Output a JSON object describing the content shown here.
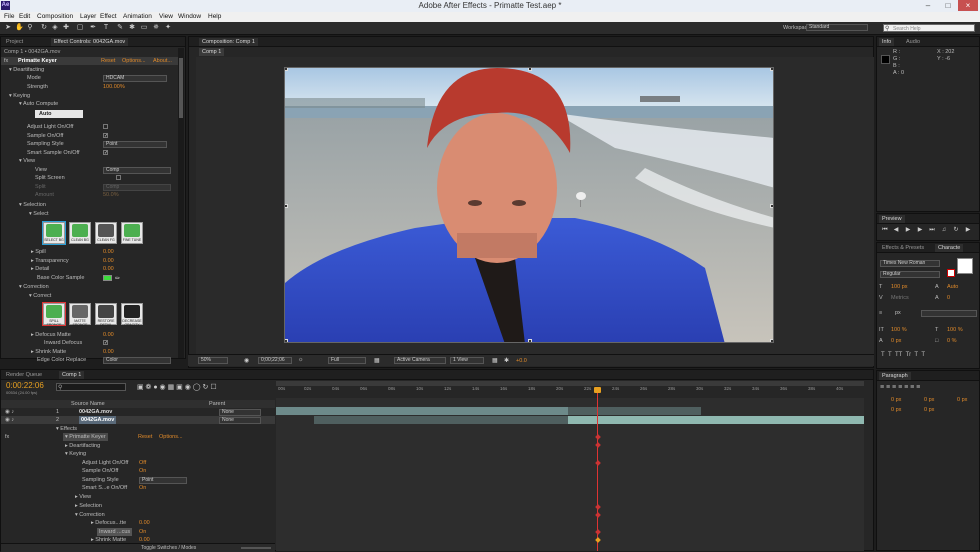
{
  "window": {
    "title": "Adobe After Effects - Primatte Test.aep *",
    "app_icon": "Ae"
  },
  "menu": [
    "File",
    "Edit",
    "Composition",
    "Layer",
    "Effect",
    "Animation",
    "View",
    "Window",
    "Help"
  ],
  "toolbar": {
    "workspace_label": "Workspace:",
    "workspace_value": "Standard",
    "search_placeholder": "Search Help"
  },
  "project_panel": {
    "tabs": [
      "Project",
      "Effect Controls: 0042GA.mov"
    ],
    "breadcrumb": "Comp 1 • 0042GA.mov",
    "effect": {
      "name": "Primatte Keyer",
      "reset": "Reset",
      "options": "Options...",
      "about": "About..."
    },
    "rows": {
      "deartifacting": "Deartifacting",
      "mode": "Mode",
      "mode_value": "HDCAM",
      "strength": "Strength",
      "strength_value": "100.00%",
      "keying": "Keying",
      "auto_compute": "Auto Compute",
      "auto_button": "Auto",
      "adjust_light": "Adjust Light On/Off",
      "sample_onoff": "Sample On/Off",
      "sampling_style": "Sampling Style",
      "sampling_style_value": "Point",
      "smart_sample": "Smart Sample On/Off",
      "view": "View",
      "view_label": "View",
      "view_value": "Comp",
      "split_screen": "Split Screen",
      "split": "Split",
      "split_value": "Comp",
      "amount": "Amount",
      "amount_value": "50.0%",
      "selection": "Selection",
      "select": "Select",
      "spill": "Spill",
      "spill_value": "0.00",
      "transparency": "Transparency",
      "transparency_value": "0.00",
      "detail": "Detail",
      "detail_value": "0.00",
      "base_color": "Base Color Sample",
      "correction": "Correction",
      "correct": "Correct",
      "defocus": "Defocus Matte",
      "defocus_value": "0.00",
      "inward": "Inward Defocus",
      "shrink": "Shrink Matte",
      "shrink_value": "0.00",
      "edge": "Edge Color Replace",
      "edge_value": "Color"
    },
    "select_buttons": [
      "SELECT BG",
      "CLEAN BG",
      "CLEAN FG",
      "FINE TUNE"
    ],
    "correct_buttons": [
      "SPILL SPONGE",
      "MATTE SPONGE",
      "RESTORE DETAIL",
      "DECREASE OPACITY"
    ]
  },
  "composition": {
    "tab": "Composition: Comp 1",
    "subtab": "Comp 1",
    "footer": {
      "zoom": "50%",
      "time": "0;00;22;06",
      "res": "Full",
      "camera": "Active Camera",
      "views": "1 View",
      "offset": "+0.0"
    }
  },
  "info_panel": {
    "tabs": [
      "Info",
      "Audio"
    ],
    "r": "R :",
    "g": "G :",
    "b": "B :",
    "a": "A : 0",
    "x": "X : 202",
    "y": "Y : -6"
  },
  "preview_panel": {
    "tab": "Preview"
  },
  "effects_panel": {
    "tabs": [
      "Effects & Presets",
      "Characte"
    ],
    "font": "Times New Roman",
    "style": "Regular",
    "size": "100 px",
    "leading": "Auto",
    "tracking_metric": "Metrics",
    "tracking": "0",
    "stroke_unit": "px",
    "scale_v": "100 %",
    "scale_h": "100 %",
    "baseline": "0 px",
    "tsume": "0 %"
  },
  "paragraph_panel": {
    "tab": "Paragraph",
    "indent1": "0 px",
    "indent2": "0 px",
    "indent3": "0 px",
    "space1": "0 px",
    "space2": "0 px"
  },
  "timeline": {
    "tabs": [
      "Render Queue",
      "Comp 1"
    ],
    "timecode": "0:00:22:06",
    "timecode_sub": "00534 (24.00 fps)",
    "columns": {
      "source": "Source Name",
      "parent": "Parent"
    },
    "layers": [
      {
        "num": "1",
        "name": "0042GA.mov",
        "parent": "None"
      },
      {
        "num": "2",
        "name": "0042GA.mov",
        "parent": "None"
      }
    ],
    "ruler": [
      "00s",
      "02s",
      "04s",
      "06s",
      "08s",
      "10s",
      "12s",
      "14s",
      "16s",
      "18s",
      "20s",
      "22s",
      "24s",
      "26s",
      "28s",
      "30s",
      "32s",
      "34s",
      "36s",
      "38s",
      "40s"
    ],
    "tree": {
      "effects": "Effects",
      "primatte": "Primatte Keyer",
      "reset": "Reset",
      "options": "Options...",
      "deart": "Deartifacting",
      "keying": "Keying",
      "adjust": "Adjust Light On/Off",
      "adjust_v": "Off",
      "sample": "Sample On/Off",
      "sample_v": "On",
      "style": "Sampling Style",
      "style_v": "Point",
      "smart": "Smart S...e On/Off",
      "smart_v": "On",
      "view": "View",
      "selection": "Selection",
      "correction": "Correction",
      "defocus": "Defocus...tte",
      "defocus_v": "0.00",
      "inward": "Inward ...cus",
      "inward_v": "On",
      "shrink": "Shrink Matte",
      "shrink_v": "0.00"
    },
    "footer": "Toggle Switches / Modes"
  }
}
